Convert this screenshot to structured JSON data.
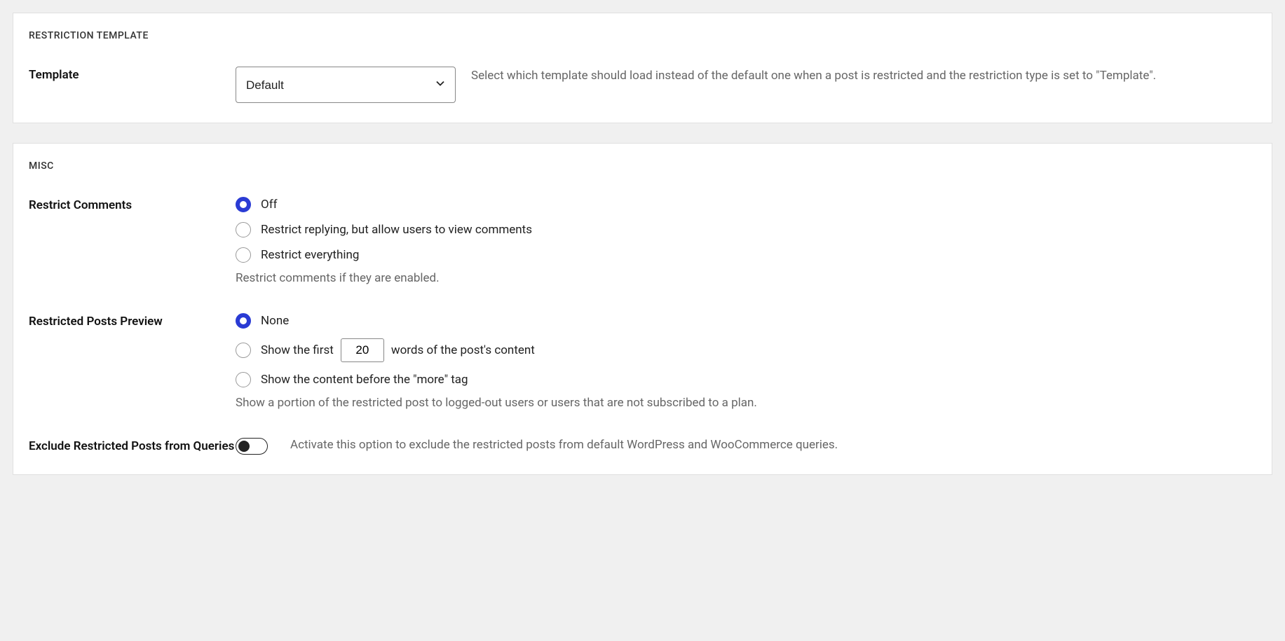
{
  "section_template": {
    "title": "RESTRICTION TEMPLATE",
    "template_label": "Template",
    "template_value": "Default",
    "template_desc": "Select which template should load instead of the default one when a post is restricted and the restriction type is set to \"Template\"."
  },
  "section_misc": {
    "title": "MISC",
    "restrict_comments": {
      "label": "Restrict Comments",
      "options": {
        "off": "Off",
        "replying": "Restrict replying, but allow users to view comments",
        "all": "Restrict everything"
      },
      "help": "Restrict comments if they are enabled."
    },
    "preview": {
      "label": "Restricted Posts Preview",
      "options": {
        "none": "None",
        "words_pre": "Show the first",
        "words_count": "20",
        "words_post": "words of the post's content",
        "more_tag": "Show the content before the \"more\" tag"
      },
      "help": "Show a portion of the restricted post to logged-out users or users that are not subscribed to a plan."
    },
    "exclude": {
      "label": "Exclude Restricted Posts from Queries",
      "desc": "Activate this option to exclude the restricted posts from default WordPress and WooCommerce queries."
    }
  }
}
